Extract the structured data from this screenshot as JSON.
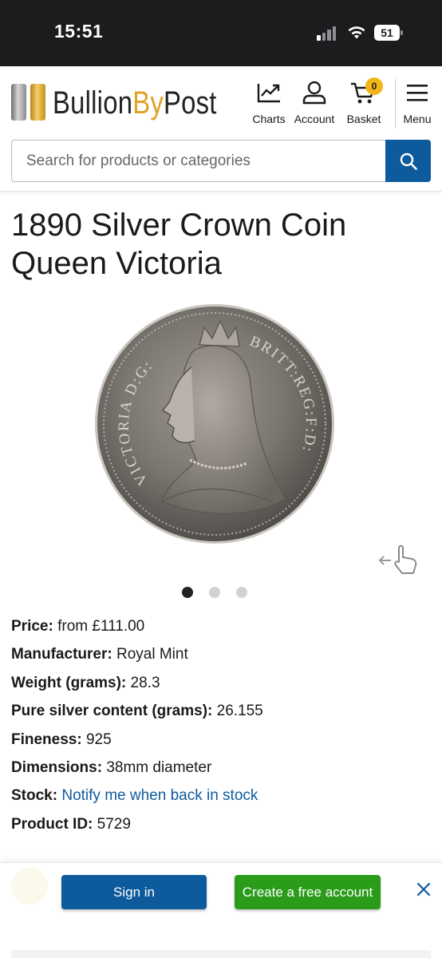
{
  "status_bar": {
    "time": "15:51",
    "battery_level": "51",
    "signal_bars_active": 1,
    "signal_bars_total": 4,
    "icons": [
      "signal-icon",
      "wifi-icon",
      "battery-icon"
    ]
  },
  "header": {
    "logo": {
      "part1": "Bullion",
      "part2": "By",
      "part3": "Post"
    },
    "nav": {
      "charts_label": "Charts",
      "account_label": "Account",
      "basket_label": "Basket",
      "basket_count": "0",
      "menu_label": "Menu"
    },
    "search": {
      "placeholder": "Search for products or categories",
      "value": ""
    }
  },
  "product": {
    "title": "1890 Silver Crown Coin Queen Victoria",
    "image_alt": "1890 Silver Crown Coin - Queen Victoria obverse",
    "coin_legend_left": "VICTORIA D:G:",
    "coin_legend_right": "BRITT:REG:F:D:",
    "carousel": {
      "active_index": 0,
      "count": 3
    },
    "specs": [
      {
        "label": "Price:",
        "value": "from £111.00"
      },
      {
        "label": "Manufacturer:",
        "value": "Royal Mint"
      },
      {
        "label": "Weight (grams):",
        "value": "28.3"
      },
      {
        "label": "Pure silver content (grams):",
        "value": "26.155"
      },
      {
        "label": "Fineness:",
        "value": "925"
      },
      {
        "label": "Dimensions:",
        "value": "38mm diameter"
      },
      {
        "label": "Stock:",
        "value": "Notify me when back in stock"
      },
      {
        "label": "Product ID:",
        "value": "5729"
      }
    ]
  },
  "signin_bar": {
    "signin_label": "Sign in",
    "create_account_label": "Create a free account"
  },
  "colors": {
    "brand_blue": "#0d5a9c",
    "brand_gold": "#e1a126",
    "cta_green": "#2a9c1a",
    "badge_yellow": "#f2b418"
  }
}
